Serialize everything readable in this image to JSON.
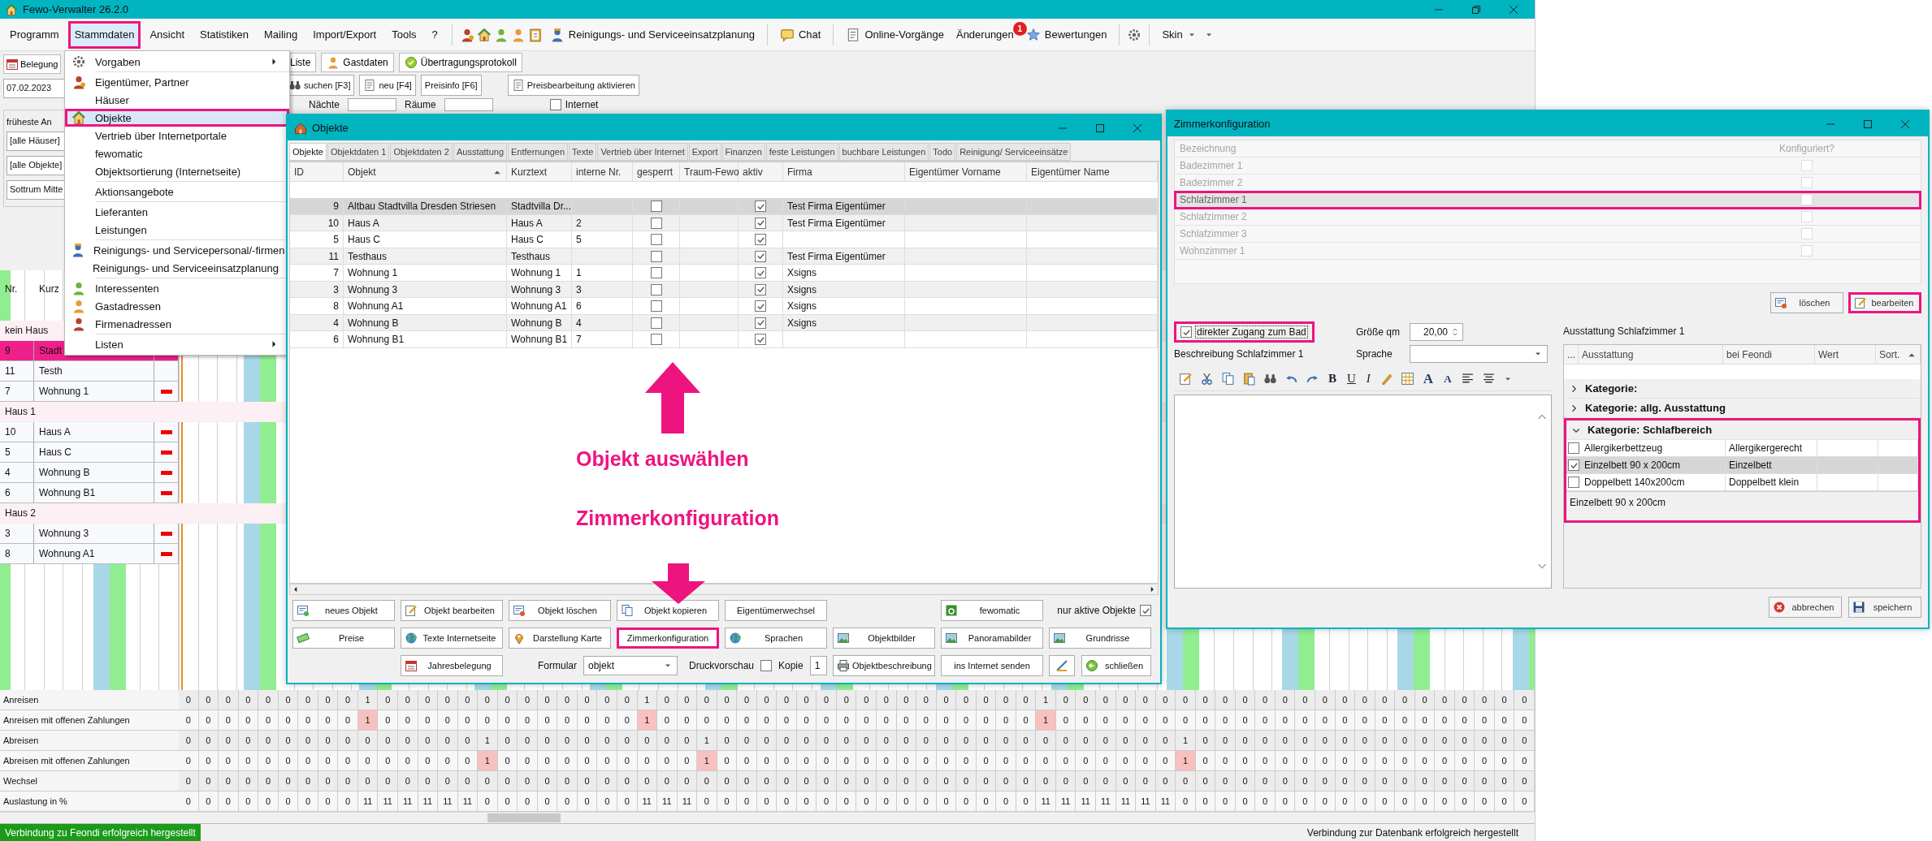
{
  "window": {
    "title": "Fewo-Verwalter 26.2.0"
  },
  "menu_bar": {
    "items": [
      {
        "label": "Programm",
        "selected": false
      },
      {
        "label": "Stammdaten",
        "selected": true
      },
      {
        "label": "Ansicht",
        "selected": false
      },
      {
        "label": "Statistiken",
        "selected": false
      },
      {
        "label": "Mailing",
        "selected": false
      },
      {
        "label": "Import/Export",
        "selected": false
      },
      {
        "label": "Tools",
        "selected": false
      },
      {
        "label": "?",
        "selected": false
      }
    ],
    "toolbar": [
      {
        "label": "Reinigungs- und Serviceeinsatzplanung"
      },
      {
        "label": "Chat"
      },
      {
        "label": "Online-Vorgänge"
      },
      {
        "label": "Änderungen",
        "badge": "1"
      },
      {
        "label": "Bewertungen"
      }
    ],
    "skin": "Skin"
  },
  "stammdaten_menu": {
    "groups": [
      [
        {
          "label": "Vorgaben",
          "kind": "tools",
          "submenu": true,
          "selected": false
        }
      ],
      [
        {
          "label": "Eigentümer, Partner",
          "kind": "owner",
          "submenu": false,
          "selected": false
        },
        {
          "label": "Häuser",
          "kind": "plain",
          "submenu": false,
          "selected": false
        },
        {
          "label": "Objekte",
          "kind": "house",
          "submenu": false,
          "selected": true
        },
        {
          "label": "Vertrieb über Internetportale",
          "kind": "plain",
          "submenu": false,
          "selected": false
        },
        {
          "label": "fewomatic",
          "kind": "plain",
          "submenu": false,
          "selected": false
        },
        {
          "label": "Objektsortierung (Internetseite)",
          "kind": "plain",
          "submenu": false,
          "selected": false
        }
      ],
      [
        {
          "label": "Aktionsangebote",
          "kind": "plain",
          "submenu": false,
          "selected": false
        }
      ],
      [
        {
          "label": "Lieferanten",
          "kind": "plain",
          "submenu": false,
          "selected": false
        },
        {
          "label": "Leistungen",
          "kind": "plain",
          "submenu": false,
          "selected": false
        }
      ],
      [
        {
          "label": "Reinigungs- und Servicepersonal/-firmen",
          "kind": "worker",
          "submenu": false,
          "selected": false
        },
        {
          "label": "Reinigungs- und Serviceeinsatzplanung",
          "kind": "plain",
          "submenu": false,
          "selected": false
        }
      ],
      [
        {
          "label": "Interessenten",
          "kind": "prospect",
          "submenu": false,
          "selected": false
        },
        {
          "label": "Gastadressen",
          "kind": "guest",
          "submenu": false,
          "selected": false
        },
        {
          "label": "Firmenadressen",
          "kind": "company",
          "submenu": false,
          "selected": false
        }
      ],
      [
        {
          "label": "Listen",
          "kind": "plain",
          "submenu": true,
          "selected": false
        }
      ]
    ]
  },
  "left_panel": {
    "tab": "Belegung",
    "date": "07.02.2023",
    "earliest_label": "früheste An",
    "filters": [
      "[alle Häuser]",
      "[alle Objekte]",
      "Sottrum Mitte"
    ]
  },
  "toolstrip": {
    "tabs": [
      "Liste",
      "Gastdaten",
      "Übertragungsprotokoll"
    ],
    "buttons": [
      "suchen [F3]",
      "neu [F4]",
      "Preisinfo [F6]"
    ],
    "price_edit": "Preisbearbeitung aktivieren",
    "nights_label": "Nächte",
    "rooms_label": "Räume",
    "internet": {
      "label": "Internet",
      "checked": false
    }
  },
  "planner": {
    "columns": [
      "Nr.",
      "Kurz"
    ],
    "groups": [
      {
        "name": "kein Haus",
        "rows": [
          {
            "nr": "9",
            "short": "Stadt",
            "selected": true
          },
          {
            "nr": "11",
            "short": "Testh",
            "selected": false
          },
          {
            "nr": "7",
            "short": "Wohnung 1",
            "selected": false,
            "marker": true
          }
        ]
      },
      {
        "name": "Haus 1",
        "rows": [
          {
            "nr": "10",
            "short": "Haus A",
            "selected": false,
            "marker": true
          },
          {
            "nr": "5",
            "short": "Haus C",
            "selected": false,
            "marker": true
          },
          {
            "nr": "4",
            "short": "Wohnung B",
            "selected": false,
            "marker": true
          },
          {
            "nr": "6",
            "short": "Wohnung B1",
            "selected": false,
            "marker": true
          }
        ]
      },
      {
        "name": "Haus 2",
        "rows": [
          {
            "nr": "3",
            "short": "Wohnung 3",
            "selected": false,
            "marker": true
          },
          {
            "nr": "8",
            "short": "Wohnung A1",
            "selected": false,
            "marker": true
          }
        ]
      }
    ]
  },
  "stats": {
    "rows": [
      {
        "label": "Anreisen",
        "kind": "count",
        "values": [
          "0",
          "0",
          "0",
          "0",
          "0",
          "0",
          "0",
          "0",
          "0",
          "1",
          "0",
          "0",
          "0",
          "0",
          "0",
          "0",
          "0",
          "0",
          "0",
          "0",
          "0",
          "0",
          "0",
          "1",
          "0",
          "0",
          "0",
          "0",
          "0",
          "0",
          "0",
          "0",
          "0",
          "0",
          "0",
          "0",
          "0",
          "0",
          "0",
          "0",
          "0",
          "0",
          "0",
          "1",
          "0",
          "0",
          "0",
          "0",
          "0",
          "0",
          "0",
          "0",
          "0",
          "0",
          "0",
          "0",
          "0",
          "0",
          "0",
          "0",
          "0",
          "0",
          "0",
          "0",
          "0",
          "0",
          "0",
          "0"
        ]
      },
      {
        "label": "Anreisen mit offenen Zahlungen",
        "kind": "open",
        "values": [
          "0",
          "0",
          "0",
          "0",
          "0",
          "0",
          "0",
          "0",
          "0",
          "1",
          "0",
          "0",
          "0",
          "0",
          "0",
          "0",
          "0",
          "0",
          "0",
          "0",
          "0",
          "0",
          "0",
          "1",
          "0",
          "0",
          "0",
          "0",
          "0",
          "0",
          "0",
          "0",
          "0",
          "0",
          "0",
          "0",
          "0",
          "0",
          "0",
          "0",
          "0",
          "0",
          "0",
          "1",
          "0",
          "0",
          "0",
          "0",
          "0",
          "0",
          "0",
          "0",
          "0",
          "0",
          "0",
          "0",
          "0",
          "0",
          "0",
          "0",
          "0",
          "0",
          "0",
          "0",
          "0",
          "0",
          "0",
          "0"
        ]
      },
      {
        "label": "Abreisen",
        "kind": "count",
        "values": [
          "0",
          "0",
          "0",
          "0",
          "0",
          "0",
          "0",
          "0",
          "0",
          "0",
          "0",
          "0",
          "0",
          "0",
          "0",
          "1",
          "0",
          "0",
          "0",
          "0",
          "0",
          "0",
          "0",
          "0",
          "0",
          "0",
          "1",
          "0",
          "0",
          "0",
          "0",
          "0",
          "0",
          "0",
          "0",
          "0",
          "0",
          "0",
          "0",
          "0",
          "0",
          "0",
          "0",
          "0",
          "0",
          "0",
          "0",
          "0",
          "0",
          "0",
          "1",
          "0",
          "0",
          "0",
          "0",
          "0",
          "0",
          "0",
          "0",
          "0",
          "0",
          "0",
          "0",
          "0",
          "0",
          "0",
          "0",
          "0"
        ]
      },
      {
        "label": "Abreisen mit offenen Zahlungen",
        "kind": "open",
        "values": [
          "0",
          "0",
          "0",
          "0",
          "0",
          "0",
          "0",
          "0",
          "0",
          "0",
          "0",
          "0",
          "0",
          "0",
          "0",
          "1",
          "0",
          "0",
          "0",
          "0",
          "0",
          "0",
          "0",
          "0",
          "0",
          "0",
          "1",
          "0",
          "0",
          "0",
          "0",
          "0",
          "0",
          "0",
          "0",
          "0",
          "0",
          "0",
          "0",
          "0",
          "0",
          "0",
          "0",
          "0",
          "0",
          "0",
          "0",
          "0",
          "0",
          "0",
          "1",
          "0",
          "0",
          "0",
          "0",
          "0",
          "0",
          "0",
          "0",
          "0",
          "0",
          "0",
          "0",
          "0",
          "0",
          "0",
          "0",
          "0"
        ]
      },
      {
        "label": "Wechsel",
        "kind": "count",
        "values": [
          "0",
          "0",
          "0",
          "0",
          "0",
          "0",
          "0",
          "0",
          "0",
          "0",
          "0",
          "0",
          "0",
          "0",
          "0",
          "0",
          "0",
          "0",
          "0",
          "0",
          "0",
          "0",
          "0",
          "0",
          "0",
          "0",
          "0",
          "0",
          "0",
          "0",
          "0",
          "0",
          "0",
          "0",
          "0",
          "0",
          "0",
          "0",
          "0",
          "0",
          "0",
          "0",
          "0",
          "0",
          "0",
          "0",
          "0",
          "0",
          "0",
          "0",
          "0",
          "0",
          "0",
          "0",
          "0",
          "0",
          "0",
          "0",
          "0",
          "0",
          "0",
          "0",
          "0",
          "0",
          "0",
          "0",
          "0",
          "0"
        ]
      },
      {
        "label": "Auslastung in %",
        "kind": "count",
        "values": [
          "0",
          "0",
          "0",
          "0",
          "0",
          "0",
          "0",
          "0",
          "0",
          "11",
          "11",
          "11",
          "11",
          "11",
          "11",
          "0",
          "0",
          "0",
          "0",
          "0",
          "0",
          "0",
          "0",
          "11",
          "11",
          "11",
          "0",
          "0",
          "0",
          "0",
          "0",
          "0",
          "0",
          "0",
          "0",
          "0",
          "0",
          "0",
          "0",
          "0",
          "0",
          "0",
          "0",
          "11",
          "11",
          "11",
          "11",
          "11",
          "11",
          "11",
          "0",
          "0",
          "0",
          "0",
          "0",
          "0",
          "0",
          "0",
          "0",
          "0",
          "0",
          "0",
          "0",
          "0",
          "0",
          "0",
          "0",
          "0"
        ]
      }
    ]
  },
  "status_bar": {
    "left": "Verbindung zu Feondi erfolgreich hergestellt",
    "right": "Verbindung zur Datenbank erfolgreich hergestellt"
  },
  "objects_window": {
    "title": "Objekte",
    "tabs": [
      {
        "label": "Objekte",
        "selected": true
      },
      {
        "label": "Objektdaten 1",
        "selected": false
      },
      {
        "label": "Objektdaten 2",
        "selected": false
      },
      {
        "label": "Ausstattung",
        "selected": false
      },
      {
        "label": "Entfernungen",
        "selected": false
      },
      {
        "label": "Texte",
        "selected": false
      },
      {
        "label": "Vertrieb über Internet",
        "selected": false
      },
      {
        "label": "Export",
        "selected": false
      },
      {
        "label": "Finanzen",
        "selected": false
      },
      {
        "label": "feste Leistungen",
        "selected": false
      },
      {
        "label": "buchbare Leistungen",
        "selected": false
      },
      {
        "label": "Todo",
        "selected": false
      },
      {
        "label": "Reinigung/ Serviceeinsätze",
        "selected": false
      }
    ],
    "columns": [
      {
        "label": "ID",
        "sorted": false
      },
      {
        "label": "Objekt",
        "sorted": true
      },
      {
        "label": "Kurztext",
        "sorted": false
      },
      {
        "label": "interne Nr.",
        "sorted": false
      },
      {
        "label": "gesperrt",
        "sorted": false
      },
      {
        "label": "Traum-Fewo",
        "sorted": false
      },
      {
        "label": "aktiv",
        "sorted": false
      },
      {
        "label": "Firma",
        "sorted": false
      },
      {
        "label": "Eigentümer Vorname",
        "sorted": false
      },
      {
        "label": "Eigentümer Name",
        "sorted": false
      }
    ],
    "rows": [
      {
        "id": "9",
        "object": "Altbau Stadtvilla Dresden Striesen",
        "short": "Stadtvilla Dr...",
        "locked": false,
        "active": true,
        "company": "Test Firma Eigentümer",
        "selected": true
      },
      {
        "id": "10",
        "object": "Haus A",
        "short": "Haus A",
        "internal": "2",
        "locked": false,
        "active": true,
        "company": "Test Firma Eigentümer",
        "selected": false
      },
      {
        "id": "5",
        "object": "Haus C",
        "short": "Haus C",
        "internal": "5",
        "locked": false,
        "active": true,
        "selected": false
      },
      {
        "id": "11",
        "object": "Testhaus",
        "short": "Testhaus",
        "locked": false,
        "active": true,
        "company": "Test Firma Eigentümer",
        "selected": false
      },
      {
        "id": "7",
        "object": "Wohnung 1",
        "short": "Wohnung 1",
        "internal": "1",
        "locked": false,
        "active": true,
        "company": "Xsigns",
        "selected": false
      },
      {
        "id": "3",
        "object": "Wohnung 3",
        "short": "Wohnung 3",
        "internal": "3",
        "locked": false,
        "active": true,
        "company": "Xsigns",
        "selected": false
      },
      {
        "id": "8",
        "object": "Wohnung A1",
        "short": "Wohnung A1",
        "internal": "6",
        "locked": false,
        "active": true,
        "company": "Xsigns",
        "selected": false
      },
      {
        "id": "4",
        "object": "Wohnung B",
        "short": "Wohnung B",
        "internal": "4",
        "locked": false,
        "active": true,
        "company": "Xsigns",
        "selected": false
      },
      {
        "id": "6",
        "object": "Wohnung B1",
        "short": "Wohnung B1",
        "internal": "7",
        "locked": false,
        "active": true,
        "selected": false
      }
    ],
    "buttons_row_1": [
      {
        "label": "neues Objekt"
      },
      {
        "label": "Objekt bearbeiten"
      },
      {
        "label": "Objekt löschen"
      },
      {
        "label": "Objekt kopieren"
      },
      {
        "label": "Eigentümerwechsel"
      }
    ],
    "fewomatic": "fewomatic",
    "only_active": {
      "label": "nur aktive Objekte",
      "checked": true
    },
    "buttons_row_2": [
      {
        "label": "Preise",
        "highlighted": false
      },
      {
        "label": "Texte Internetseite",
        "highlighted": false
      },
      {
        "label": "Darstellung Karte",
        "highlighted": false
      },
      {
        "label": "Zimmerkonfiguration",
        "highlighted": true
      },
      {
        "label": "Sprachen",
        "highlighted": false
      },
      {
        "label": "Objektbilder",
        "highlighted": false
      },
      {
        "label": "Panoramabilder",
        "highlighted": false
      },
      {
        "label": "Grundrisse",
        "highlighted": false
      }
    ],
    "yearly": "Jahresbelegung",
    "form": {
      "label": "Formular",
      "value": "objekt"
    },
    "preview": {
      "label": "Druckvorschau",
      "checked": false
    },
    "copies": {
      "label": "Kopie",
      "value": "1"
    },
    "buttons_row_3": [
      "Objektbeschreibung",
      "ins Internet senden"
    ],
    "close": "schließen",
    "annotations": [
      "Objekt auswählen",
      "Zimmerkonfiguration"
    ]
  },
  "rooms_window": {
    "title": "Zimmerkonfiguration",
    "rooms_disabled": true,
    "columns": [
      "Bezeichnung",
      "Konfiguriert?"
    ],
    "rooms": [
      {
        "name": "Badezimmer 1",
        "configured": false,
        "selected": false
      },
      {
        "name": "Badezimmer 2",
        "configured": false,
        "selected": false
      },
      {
        "name": "Schlafzimmer 1",
        "configured": false,
        "selected": true
      },
      {
        "name": "Schlafzimmer 2",
        "configured": false,
        "selected": false
      },
      {
        "name": "Schlafzimmer 3",
        "configured": false,
        "selected": false
      },
      {
        "name": "Wohnzimmer 1",
        "configured": false,
        "selected": false
      }
    ],
    "room_buttons": [
      {
        "label": "löschen",
        "highlighted": false
      },
      {
        "label": "bearbeiten",
        "highlighted": true
      }
    ],
    "direct_bath": {
      "label": "direkter Zugang zum Bad",
      "checked": true,
      "highlighted": true
    },
    "size": {
      "label": "Größe qm",
      "value": "20,00"
    },
    "description_label": "Beschreibung Schlafzimmer 1",
    "language_label": "Sprache",
    "editor_toolbar": {
      "format": [
        "B",
        "U",
        "I"
      ],
      "font_size": [
        "A",
        "A"
      ]
    },
    "equipment_label": "Ausstattung Schlafzimmer 1",
    "equipment_columns": [
      "...",
      "Ausstattung",
      "bei Feondi",
      "Wert",
      "Sort."
    ],
    "categories": [
      {
        "name": "Kategorie:",
        "expanded": false,
        "highlighted": false
      },
      {
        "name": "Kategorie: allg. Ausstattung",
        "expanded": false,
        "highlighted": false
      },
      {
        "name": "Kategorie: Schlafbereich",
        "expanded": true,
        "highlighted": true,
        "items": [
          {
            "name": "Allergikerbettzeug",
            "feondi": "Allergikergerecht",
            "checked": false,
            "selected": false
          },
          {
            "name": "Einzelbett 90 x 200cm",
            "feondi": "Einzelbett",
            "checked": true,
            "selected": true
          },
          {
            "name": "Doppelbett 140x200cm",
            "feondi": "Doppelbett klein",
            "checked": false,
            "selected": false
          }
        ]
      }
    ],
    "detail": "Einzelbett 90 x 200cm",
    "footer_buttons": [
      "abbrechen",
      "speichern"
    ]
  }
}
